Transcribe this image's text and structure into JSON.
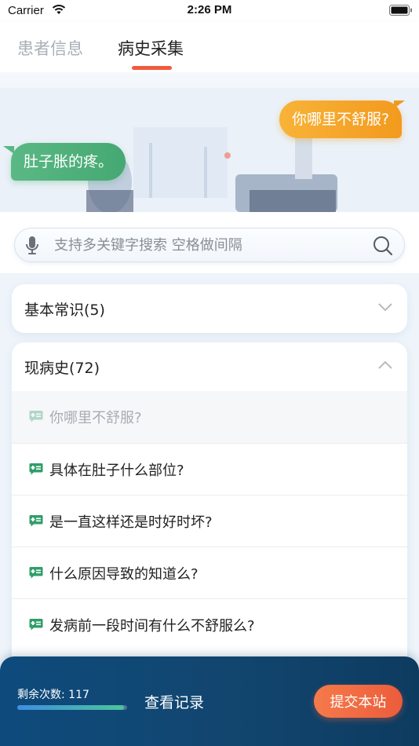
{
  "status_bar": {
    "carrier": "Carrier",
    "time": "2:26 PM"
  },
  "tabs": [
    {
      "label": "患者信息",
      "active": false
    },
    {
      "label": "病史采集",
      "active": true
    }
  ],
  "banner": {
    "doctor_message": "你哪里不舒服?",
    "patient_message": "肚子胀的疼。"
  },
  "search": {
    "placeholder": "支持多关键字搜索 空格做间隔",
    "value": ""
  },
  "sections": [
    {
      "title": "基本常识(5)",
      "expanded": false
    },
    {
      "title": "现病史(72)",
      "expanded": true,
      "questions": [
        {
          "text": "你哪里不舒服?",
          "asked": true
        },
        {
          "text": "具体在肚子什么部位?",
          "asked": false
        },
        {
          "text": "是一直这样还是时好时坏?",
          "asked": false
        },
        {
          "text": "什么原因导致的知道么?",
          "asked": false
        },
        {
          "text": "发病前一段时间有什么不舒服么?",
          "asked": false
        }
      ]
    }
  ],
  "bottom": {
    "remaining_label": "剩余次数: 117",
    "remaining_progress": 0.97,
    "history_label": "查看记录",
    "submit_label": "提交本站"
  },
  "colors": {
    "accent": "#f05a3c",
    "doctor_bubble": "#f29a1e",
    "patient_bubble": "#45a872",
    "bottom_bar": "#12466f",
    "question_icon": "#2f9e6a"
  }
}
